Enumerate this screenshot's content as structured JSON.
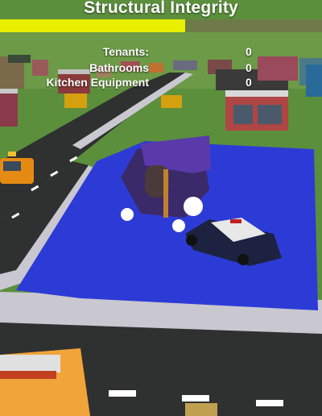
{
  "hud": {
    "title": "Structural Integrity",
    "integrity_fraction": 0.575,
    "bar_color": "#e8f000",
    "stats": [
      {
        "label": "Tenants:",
        "value": "0"
      },
      {
        "label": "Bathrooms",
        "value": "0"
      },
      {
        "label": "Kitchen Equipment",
        "value": "0"
      }
    ]
  },
  "scene": {
    "colors": {
      "grass": "#5b8f3c",
      "road": "#2f3030",
      "sidewalk": "#c9c7cf",
      "water": "#2d3bd6",
      "police_car": "#1c2240"
    }
  }
}
